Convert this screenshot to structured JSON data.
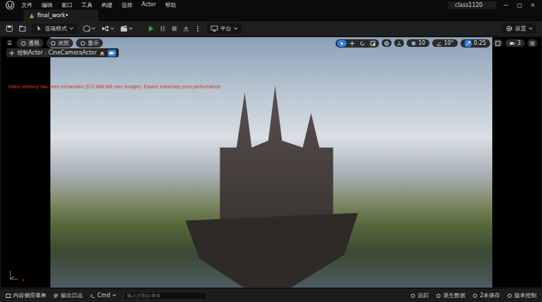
{
  "window": {
    "title": "class1120",
    "controls": [
      "—",
      "□",
      "×"
    ]
  },
  "menu": [
    "文件",
    "编辑",
    "窗口",
    "工具",
    "构建",
    "选择",
    "Actor",
    "帮助"
  ],
  "tabs": [
    {
      "label": "final_work•",
      "selected": true
    }
  ],
  "toolbar": {
    "mode": "选项模式",
    "platform": "平台",
    "settings": "设置"
  },
  "viewport": {
    "menu_glyph": "☰",
    "view_buttons": [
      {
        "label": "透视"
      },
      {
        "label": "光照"
      },
      {
        "label": "显示"
      }
    ],
    "transform_tools": [
      {
        "kind": "select",
        "selected": true
      },
      {
        "kind": "move",
        "selected": false
      },
      {
        "kind": "rotate",
        "selected": false
      },
      {
        "kind": "scale",
        "selected": false
      }
    ],
    "grid_snap": "10",
    "rotation_snap": "10°",
    "scale_snap": "0.25",
    "camera_speed": "3",
    "pilot_label": "控制Actor：CineCameraActor",
    "warning": "Video memory has been exhausted (572.648 MB over budget). Expect extremely poor performance.",
    "gizmo_label": "x"
  },
  "status_bar": {
    "left": [
      "内容侧滑菜单",
      "输出日志"
    ],
    "cmd": "Cmd",
    "console_placeholder": "输入控制台命令",
    "right": [
      "追踪",
      "派生数据",
      "2未保存",
      "版本控制"
    ]
  }
}
